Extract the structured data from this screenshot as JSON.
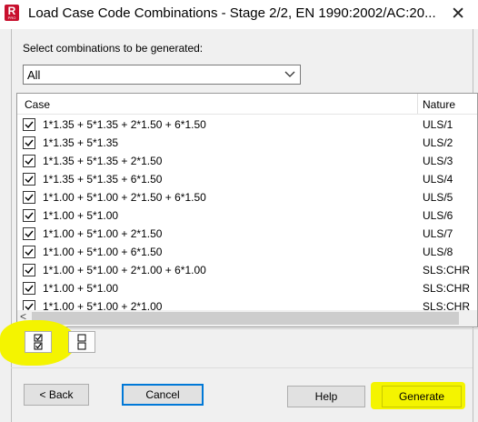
{
  "window": {
    "title": "Load Case Code Combinations - Stage 2/2, EN 1990:2002/AC:20...",
    "app_icon": {
      "letter": "R",
      "sub": "PRO",
      "color": "#c8102e"
    },
    "close_label": "✕"
  },
  "prompt": "Select combinations to be generated:",
  "filter": {
    "selected": "All"
  },
  "table": {
    "headers": {
      "case": "Case",
      "nature": "Nature"
    },
    "rows": [
      {
        "case": "1*1.35 + 5*1.35 + 2*1.50 + 6*1.50",
        "nature": "ULS/1",
        "checked": true
      },
      {
        "case": "1*1.35 + 5*1.35",
        "nature": "ULS/2",
        "checked": true
      },
      {
        "case": "1*1.35 + 5*1.35 + 2*1.50",
        "nature": "ULS/3",
        "checked": true
      },
      {
        "case": "1*1.35 + 5*1.35 + 6*1.50",
        "nature": "ULS/4",
        "checked": true
      },
      {
        "case": "1*1.00 + 5*1.00 + 2*1.50 + 6*1.50",
        "nature": "ULS/5",
        "checked": true
      },
      {
        "case": "1*1.00 + 5*1.00",
        "nature": "ULS/6",
        "checked": true
      },
      {
        "case": "1*1.00 + 5*1.00 + 2*1.50",
        "nature": "ULS/7",
        "checked": true
      },
      {
        "case": "1*1.00 + 5*1.00 + 6*1.50",
        "nature": "ULS/8",
        "checked": true
      },
      {
        "case": "1*1.00 + 5*1.00 + 2*1.00 + 6*1.00",
        "nature": "SLS:CHR",
        "checked": true
      },
      {
        "case": "1*1.00 + 5*1.00",
        "nature": "SLS:CHR",
        "checked": true
      },
      {
        "case": "1*1.00 + 5*1.00 + 2*1.00",
        "nature": "SLS:CHR",
        "checked": true
      }
    ]
  },
  "scrollbar": {
    "left_arrow": "<"
  },
  "tools": {
    "select_all_icon": "check-all-icon",
    "deselect_all_icon": "uncheck-all-icon"
  },
  "buttons": {
    "back": "< Back",
    "cancel": "Cancel",
    "help": "Help",
    "generate": "Generate"
  },
  "colors": {
    "highlight": "#f4f400",
    "focus_border": "#0078d7"
  }
}
